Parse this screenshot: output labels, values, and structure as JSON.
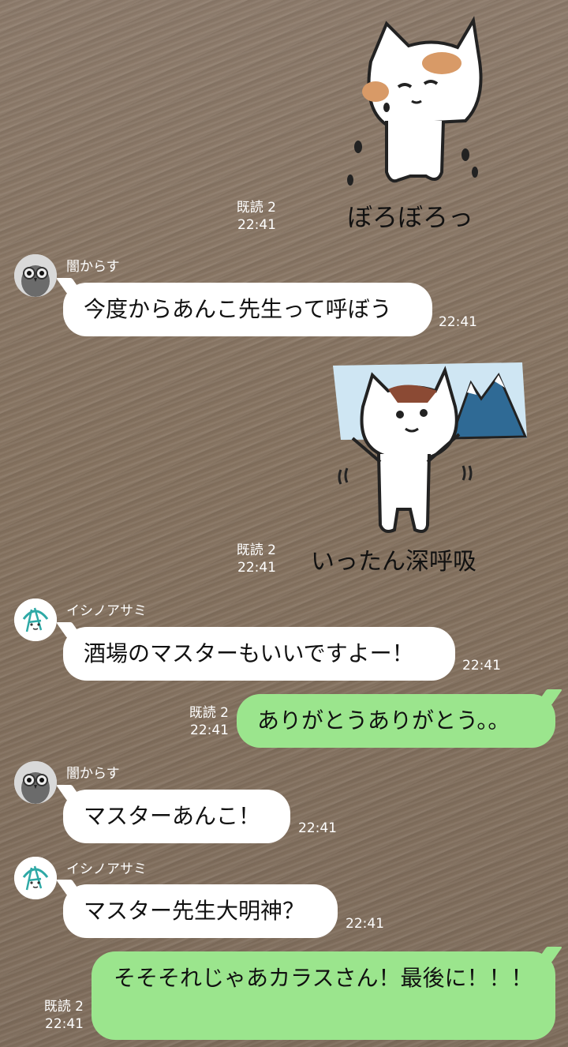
{
  "messages": [
    {
      "type": "sticker",
      "side": "right",
      "caption": "ぼろぼろっ",
      "read": "既読 2",
      "time": "22:41"
    },
    {
      "type": "text",
      "side": "left",
      "sender": "闇からす",
      "text": "今度からあんこ先生って呼ぼう",
      "time": "22:41"
    },
    {
      "type": "sticker",
      "side": "right",
      "caption": "いったん深呼吸",
      "read": "既読 2",
      "time": "22:41"
    },
    {
      "type": "text",
      "side": "left",
      "sender": "イシノアサミ",
      "text": "酒場のマスターもいいですよー！",
      "time": "22:41"
    },
    {
      "type": "text",
      "side": "right",
      "text": "ありがとうありがとう。。",
      "read": "既読 2",
      "time": "22:41"
    },
    {
      "type": "text",
      "side": "left",
      "sender": "闇からす",
      "text": "マスターあんこ！",
      "time": "22:41"
    },
    {
      "type": "text",
      "side": "left",
      "sender": "イシノアサミ",
      "text": "マスター先生大明神？",
      "time": "22:41"
    },
    {
      "type": "text",
      "side": "right",
      "text": "そそそれじゃあカラスさん！最後に！！！",
      "read": "既読 2",
      "time": "22:41"
    }
  ],
  "colors": {
    "own_bubble": "#9be58d",
    "other_bubble": "#ffffff",
    "meta_text": "#ffffff"
  }
}
